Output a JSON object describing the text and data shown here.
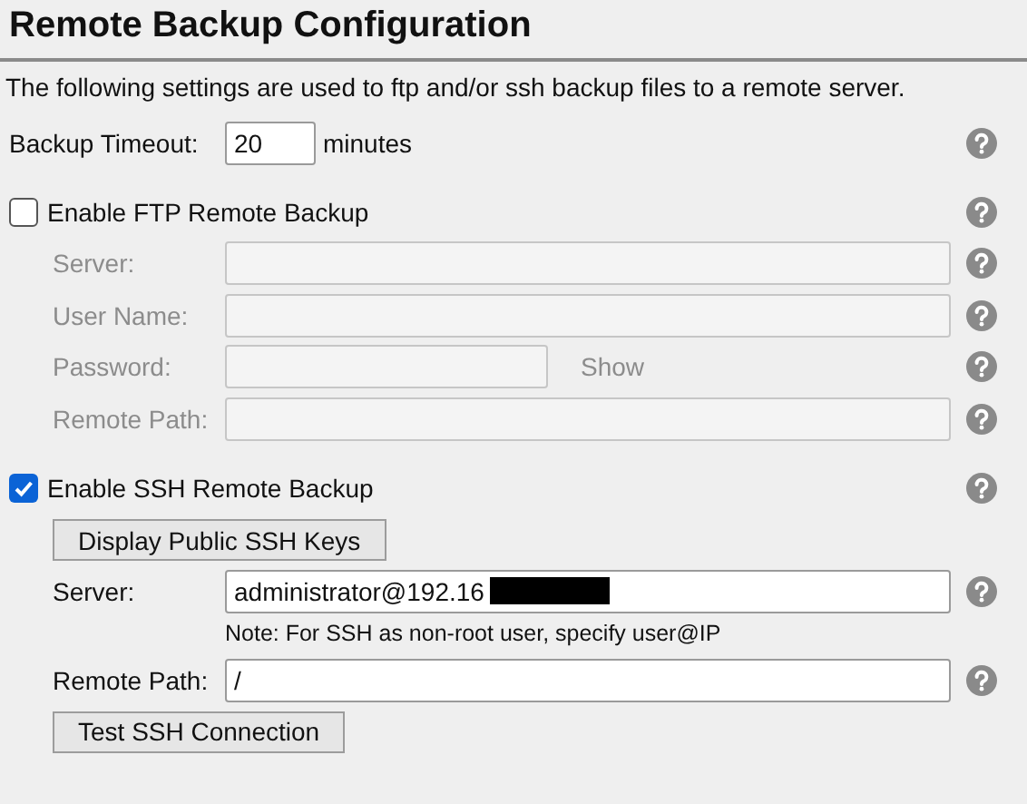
{
  "title": "Remote Backup Configuration",
  "description": "The following settings are used to ftp and/or ssh backup files to a remote server.",
  "timeout": {
    "label": "Backup Timeout:",
    "value": "20",
    "unit": "minutes"
  },
  "ftp": {
    "label": "Enable FTP Remote Backup",
    "checked": false,
    "fields": [
      {
        "kind": "text",
        "label": "Server:",
        "disabled": true
      },
      {
        "kind": "text",
        "label": "User Name:",
        "disabled": true
      },
      {
        "kind": "password",
        "label": "Password:",
        "toggle": "Show",
        "disabled": true
      },
      {
        "kind": "text",
        "label": "Remote Path:",
        "disabled": true
      }
    ]
  },
  "ssh": {
    "label": "Enable SSH Remote Backup",
    "checked": true,
    "keys_button": "Display Public SSH Keys",
    "fields": [
      {
        "kind": "text",
        "label": "Server:",
        "value": "administrator@192.16",
        "redacted": true,
        "note": "Note: For SSH as non-root user, specify user@IP",
        "disabled": false
      },
      {
        "kind": "text",
        "label": "Remote Path:",
        "value": "/",
        "disabled": false
      }
    ],
    "test_button": "Test SSH Connection"
  }
}
